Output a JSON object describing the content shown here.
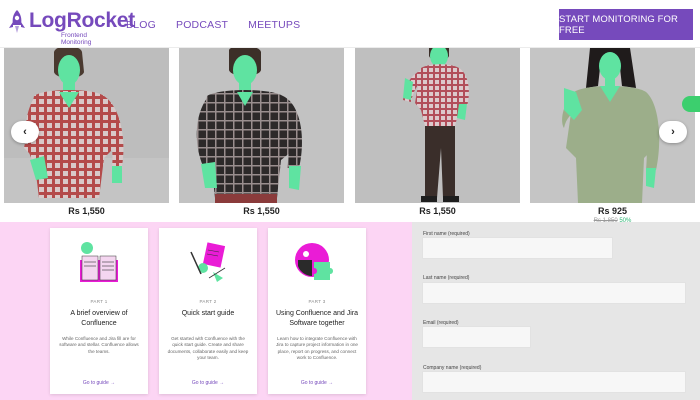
{
  "header": {
    "logo_text": "LogRocket",
    "logo_sub": "Frontend Monitoring",
    "nav": [
      "BLOG",
      "PODCAST",
      "MEETUPS"
    ],
    "cta_label": "START MONITORING FOR FREE"
  },
  "colors": {
    "brand": "#764abc",
    "pink_panel": "#fcd5f4",
    "gray_panel": "#e6e6e6",
    "green_overlay": "#5fe3a1"
  },
  "products": [
    {
      "price": "Rs 1,550",
      "shirt": "red-check-shirt"
    },
    {
      "price": "Rs 1,550",
      "shirt": "black-check-shirt"
    },
    {
      "price": "Rs 1,550",
      "shirt": "red-check-shirt-full"
    },
    {
      "price": "Rs 925",
      "price_original": "Rs 1,850",
      "discount": "50%",
      "shirt": "olive-shirt"
    }
  ],
  "carousel": {
    "prev_icon": "chevron-left-icon",
    "next_icon": "chevron-right-icon",
    "prev_glyph": "‹",
    "next_glyph": "›"
  },
  "cards": [
    {
      "part": "PART 1",
      "title": "A brief overview of Confluence",
      "desc": "While Confluence and Jira fill are for software and stellar. Confluence allows the teams.",
      "link": "Go to guide →"
    },
    {
      "part": "PART 2",
      "title": "Quick start guide",
      "desc": "Get started with Confluence with the quick start guide. Create and share documents, collaborate easily and keep your team.",
      "link": "Go to guide →"
    },
    {
      "part": "PART 3",
      "title": "Using Confluence and Jira Software together",
      "desc": "Learn how to integrate Confluence with Jira to capture project information in one place, report on progress, and connect work to Confluence.",
      "link": "Go to guide →"
    }
  ],
  "form": {
    "fields": [
      {
        "label": "First name (required)"
      },
      {
        "label": "Last name (required)"
      },
      {
        "label": "Email (required)"
      },
      {
        "label": "Company name (required)"
      }
    ]
  }
}
